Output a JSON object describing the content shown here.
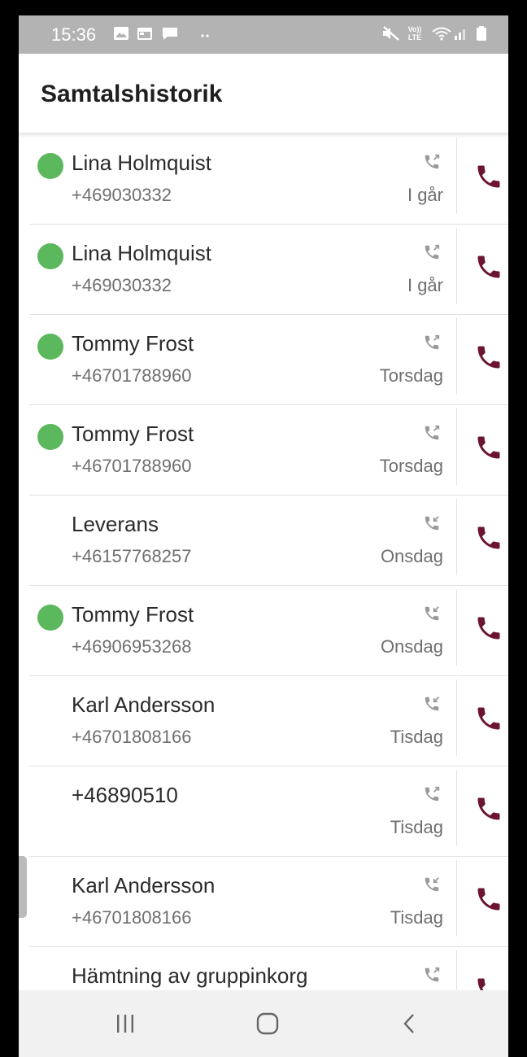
{
  "status_bar": {
    "time": "15:36",
    "left_icons": [
      "image-icon",
      "calendar-icon",
      "chat-icon",
      "more-dots-icon"
    ],
    "right_icons": [
      "mute-icon",
      "volte-icon",
      "wifi-icon",
      "signal-icon",
      "battery-icon"
    ],
    "volte_text": "Vo)) LTE"
  },
  "app_bar": {
    "title": "Samtalshistorik"
  },
  "colors": {
    "presence_green": "#5cb85c",
    "call_icon": "#6b1530",
    "direction_icon": "#9a9a9a"
  },
  "calls": [
    {
      "name": "Lina Holmquist",
      "number": "+469030332",
      "date": "I går",
      "online": true,
      "direction": "outgoing"
    },
    {
      "name": "Lina Holmquist",
      "number": "+469030332",
      "date": "I går",
      "online": true,
      "direction": "outgoing"
    },
    {
      "name": "Tommy Frost",
      "number": "+46701788960",
      "date": "Torsdag",
      "online": true,
      "direction": "outgoing"
    },
    {
      "name": "Tommy Frost",
      "number": "+46701788960",
      "date": "Torsdag",
      "online": true,
      "direction": "outgoing"
    },
    {
      "name": "Leverans",
      "number": "+46157768257",
      "date": "Onsdag",
      "online": false,
      "direction": "incoming"
    },
    {
      "name": "Tommy Frost",
      "number": "+46906953268",
      "date": "Onsdag",
      "online": true,
      "direction": "incoming"
    },
    {
      "name": "Karl Andersson",
      "number": "+46701808166",
      "date": "Tisdag",
      "online": false,
      "direction": "incoming"
    },
    {
      "name": "+46890510",
      "number": "",
      "date": "Tisdag",
      "online": false,
      "direction": "outgoing"
    },
    {
      "name": "Karl Andersson",
      "number": "+46701808166",
      "date": "Tisdag",
      "online": false,
      "direction": "incoming"
    },
    {
      "name": "Hämtning av gruppinkorg",
      "number": "",
      "date": "",
      "online": false,
      "direction": "outgoing"
    }
  ],
  "nav_bar": {
    "buttons": [
      "recent-apps-icon",
      "home-icon",
      "back-icon"
    ]
  }
}
